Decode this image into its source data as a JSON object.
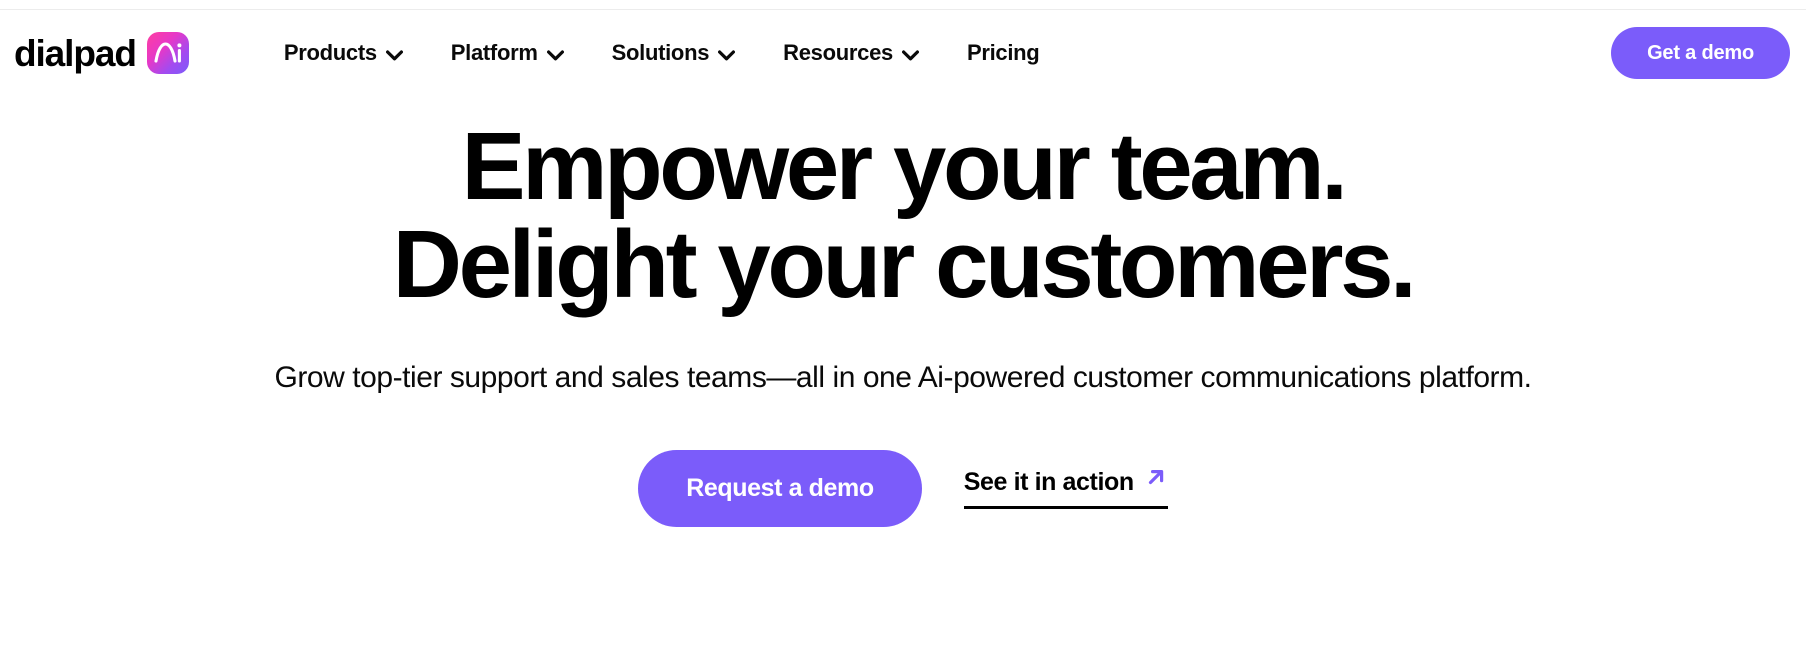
{
  "brand": {
    "wordmark": "dialpad",
    "badge_label": "Ai",
    "badge_gradient_from": "#ff3ea0",
    "badge_gradient_to": "#7b5cfa"
  },
  "nav": {
    "items": [
      {
        "label": "Products",
        "has_dropdown": true,
        "icon": "chevron-down-icon"
      },
      {
        "label": "Platform",
        "has_dropdown": true,
        "icon": "chevron-down-icon"
      },
      {
        "label": "Solutions",
        "has_dropdown": true,
        "icon": "chevron-down-icon"
      },
      {
        "label": "Resources",
        "has_dropdown": true,
        "icon": "chevron-down-icon"
      },
      {
        "label": "Pricing",
        "has_dropdown": false,
        "icon": ""
      }
    ],
    "cta_label": "Get a demo",
    "cta_color": "#7b5cfa"
  },
  "hero": {
    "title_line1": "Empower your team.",
    "title_line2": "Delight your customers.",
    "subtitle": "Grow top-tier support and sales teams—all in one Ai-powered customer communications platform.",
    "primary_cta": "Request a demo",
    "primary_cta_color": "#7b5cfa",
    "secondary_cta": "See it in action",
    "secondary_cta_icon": "arrow-up-right-icon",
    "secondary_cta_icon_color": "#7b5cfa"
  }
}
